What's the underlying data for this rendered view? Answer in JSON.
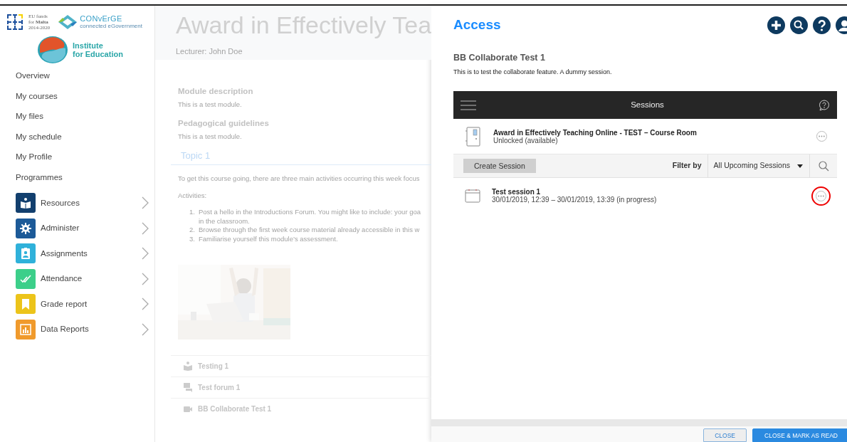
{
  "logos": {
    "eu_funds": [
      "EU funds",
      "for **Malta**",
      "2014-2020"
    ],
    "converge": {
      "name": "CONvErGE",
      "tagline": "connected eGovernment"
    },
    "institute": [
      "Institute",
      "for Education"
    ]
  },
  "sidebar": {
    "links": [
      "Overview",
      "My courses",
      "My files",
      "My schedule",
      "My Profile",
      "Programmes"
    ],
    "modules": [
      {
        "label": "Resources",
        "color": "#123f6e"
      },
      {
        "label": "Administer",
        "color": "#1c5a98"
      },
      {
        "label": "Assignments",
        "color": "#2fb1da"
      },
      {
        "label": "Attendance",
        "color": "#3ccf8a"
      },
      {
        "label": "Grade report",
        "color": "#ecc41a"
      },
      {
        "label": "Data Reports",
        "color": "#f09a2c"
      }
    ]
  },
  "course": {
    "title": "Award in Effectively Tea",
    "lecturer": "Lecturer: John Doe",
    "sections": [
      {
        "heading": "Module description",
        "text": "This is a test module."
      },
      {
        "heading": "Pedagogical guidelines",
        "text": "This is a test module."
      }
    ],
    "topic": "Topic 1",
    "intro": "To get this course going, there are three main activities occurring this week focus",
    "activities_label": "Activities:",
    "activities": [
      {
        "number": "1.",
        "lines": [
          "Post a hello in the Introductions Forum. You might like to include: your goa",
          "in the classroom."
        ]
      },
      {
        "number": "2.",
        "lines": [
          "Browse through the first week course material already accessible in this w"
        ]
      },
      {
        "number": "3.",
        "lines": [
          "Familiarise yourself this module’s assessment."
        ]
      }
    ],
    "items": [
      "Testing 1",
      "Test forum 1",
      "BB Collaborate Test 1"
    ]
  },
  "panel": {
    "title": "Access",
    "name": "BB Collaborate Test 1",
    "description": "This is to test the collaborate feature. A dummy session.",
    "sessions_title": "Sessions",
    "room": {
      "title": "Award in Effectively Teaching Online - TEST – Course Room",
      "status": "Unlocked (available)"
    },
    "create_button": "Create Session",
    "filter_label": "Filter by",
    "filter_value": "All Upcoming Sessions",
    "sessions": [
      {
        "title": "Test session 1",
        "time": "30/01/2019, 12:39 – 30/01/2019, 13:39 (in progress)",
        "highlighted": true
      }
    ],
    "buttons": [
      {
        "label": "CLOSE",
        "kind": "outline"
      },
      {
        "label": "CLOSE & MARK AS READ",
        "kind": "primary"
      }
    ]
  }
}
